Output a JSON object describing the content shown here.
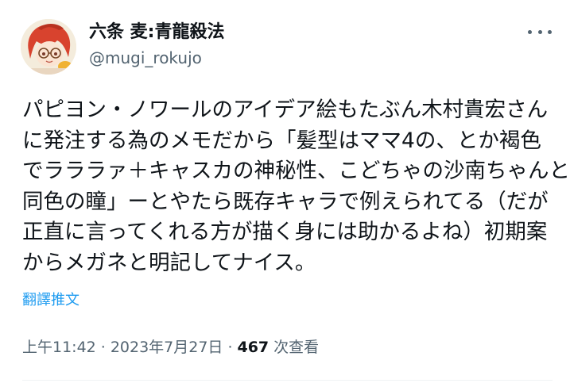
{
  "author": {
    "display_name": "六条 麦:青龍殺法",
    "handle": "@mugi_rokujo"
  },
  "tweet": {
    "lines": [
      "パピヨン・ノワールのアイデア絵もたぶん木村貴宏さん",
      "に発注する為のメモだから「髪型はママ4の、とか褐色",
      "でラララァ＋キャスカの神秘性、こどちゃの沙南ちゃんと",
      "同色の瞳」ーとやたら既存キャラで例えられてる（だが",
      "正直に言ってくれる方が描く身には助かるよね）初期案",
      "からメガネと明記してナイス。"
    ],
    "translate_label": "翻譯推文"
  },
  "meta": {
    "time": "上午11:42",
    "separator": "·",
    "date": "2023年7月27日",
    "views_count": "467",
    "views_label": "次查看"
  },
  "colors": {
    "link": "#1d9bf0",
    "secondary_text": "#536471",
    "primary_text": "#0f1419"
  },
  "icons": {
    "more": "more-options-icon"
  }
}
